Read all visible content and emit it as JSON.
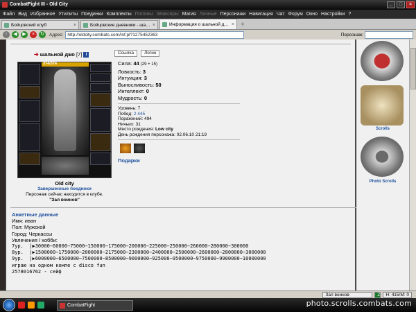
{
  "window": {
    "title": "CombatFight III - Old City"
  },
  "menu": [
    "Файл",
    "Вид",
    "Избранное",
    "Утилиты",
    "Поединки",
    "Комплекты",
    "Полоны",
    "Эликсиры",
    "Магия",
    "Личные",
    "Персонажи",
    "Навигация",
    "Чат",
    "Форум",
    "Окно",
    "Настройки",
    "?"
  ],
  "tabs": [
    {
      "label": "Бойцовский клуб"
    },
    {
      "label": "Бойцовские дневники - шальной джо"
    },
    {
      "label": "Информация о шальной джо"
    }
  ],
  "nav": {
    "address_label": "Адрес:",
    "url": "http://oldcity.combats.com/inf.pl?1275452363",
    "search_label": "Персонаж:"
  },
  "character": {
    "name": "шальной джо",
    "level": "[7]",
    "badge": "i",
    "hp": "374/374",
    "btn_link": "Ссылка",
    "btn_login": "Логин",
    "city": "Old city",
    "fights_link": "Завершенные поединки",
    "location_text": "Персонаж сейчас находится в клубе.",
    "room": "\"Зал воинов\""
  },
  "stats": [
    {
      "label": "Сила:",
      "value": "44",
      "bonus": "(29 + 15)"
    },
    {
      "label": "Ловкость:",
      "value": "3",
      "bonus": ""
    },
    {
      "label": "Интуиция:",
      "value": "3",
      "bonus": ""
    },
    {
      "label": "Выносливость:",
      "value": "50",
      "bonus": ""
    },
    {
      "label": "Интеллект:",
      "value": "0",
      "bonus": ""
    },
    {
      "label": "Мудрость:",
      "value": "0",
      "bonus": ""
    }
  ],
  "info": [
    {
      "label": "Уровень:",
      "value": "7"
    },
    {
      "label": "Побед:",
      "value": "2 445"
    },
    {
      "label": "Поражений:",
      "value": "494"
    },
    {
      "label": "Ничьих:",
      "value": "31"
    },
    {
      "label": "Место рождения:",
      "value": "Low city"
    },
    {
      "label": "День рождения персонажа:",
      "value": "02.06.10 21:19"
    }
  ],
  "gifts_label": "Подарки",
  "anket": {
    "title": "Анкетные данные",
    "name": "Имя: иван",
    "gender": "Пол: Мужской",
    "city": "Город: Черкассы",
    "hobby": "Увлечения / хобби:",
    "lines": [
      "7ур.  |▶30000−60000−75000−150000−175000−200000−225000−250000−260000−280000−300000",
      "8ур.  |▶1500000−1750000−2000000−2175000−2300000−2400000−2500000−2600000−2800000−3000000",
      "9ур.  |▶6000000−6500000−7500000−8500000−9000000−925000−9500000−9750000−9900000−10000000",
      "",
      "играю на одном компе с disco fun",
      "",
      "2578016762 - сейф"
    ]
  },
  "right_panel": {
    "scrolls": "Scrolls",
    "photo": "Photo Scrolls"
  },
  "statusbar": {
    "room": "Зал воинов",
    "h": "H: 415/M: 0",
    "z": "Z"
  },
  "taskbar": {
    "item": "CombatFight"
  },
  "watermark": "photo.scrolls.combats.com"
}
